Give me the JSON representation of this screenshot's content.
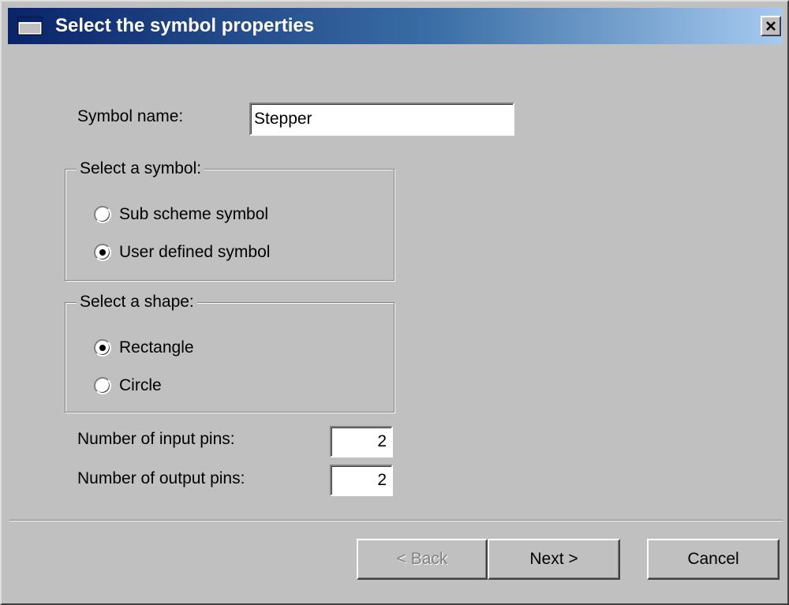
{
  "window": {
    "title": "Select the symbol properties"
  },
  "titlebar": {
    "icon": "window-icon",
    "close_icon": "close-icon"
  },
  "symbol_name": {
    "label": "Symbol name:",
    "value": "Stepper"
  },
  "symbol_group": {
    "title": "Select a symbol:",
    "options": [
      {
        "label": "Sub scheme symbol",
        "checked": false
      },
      {
        "label": "User defined symbol",
        "checked": true
      }
    ]
  },
  "shape_group": {
    "title": "Select a shape:",
    "options": [
      {
        "label": "Rectangle",
        "checked": true
      },
      {
        "label": "Circle",
        "checked": false
      }
    ]
  },
  "input_pins": {
    "label": "Number of input pins:",
    "value": "2"
  },
  "output_pins": {
    "label": "Number of output pins:",
    "value": "2"
  },
  "buttons": {
    "back": {
      "label": "< Back",
      "enabled": false
    },
    "next": {
      "label": "Next >",
      "enabled": true
    },
    "cancel": {
      "label": "Cancel",
      "enabled": true
    }
  },
  "colors": {
    "title_start": "#0a246a",
    "title_end": "#a6caf0",
    "face": "#c0c0c0"
  }
}
